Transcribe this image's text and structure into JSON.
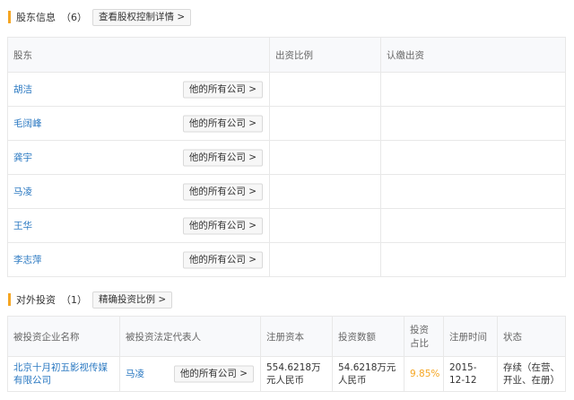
{
  "shareholders": {
    "title": "股东信息",
    "count": "（6）",
    "detail_button": "查看股权控制详情 >",
    "columns": [
      "股东",
      "出资比例",
      "认缴出资"
    ],
    "companies_button": "他的所有公司 >",
    "rows": [
      {
        "name": "胡洁",
        "ratio": "",
        "amount": ""
      },
      {
        "name": "毛阔峰",
        "ratio": "",
        "amount": ""
      },
      {
        "name": "龚宇",
        "ratio": "",
        "amount": ""
      },
      {
        "name": "马凌",
        "ratio": "",
        "amount": ""
      },
      {
        "name": "王华",
        "ratio": "",
        "amount": ""
      },
      {
        "name": "李志萍",
        "ratio": "",
        "amount": ""
      }
    ]
  },
  "investments": {
    "title": "对外投资",
    "count": "（1）",
    "ratio_button": "精确投资比例 >",
    "columns": [
      "被投资企业名称",
      "被投资法定代表人",
      "注册资本",
      "投资数额",
      "投资占比",
      "注册时间",
      "状态"
    ],
    "companies_button": "他的所有公司 >",
    "rows": [
      {
        "company": "北京十月初五影视传媒有限公司",
        "legal_rep": "马凌",
        "capital": "554.6218万元人民币",
        "amount": "54.6218万元人民币",
        "ratio": "9.85%",
        "date": "2015-12-12",
        "status": "存续（在营、开业、在册）"
      }
    ]
  },
  "colors": {
    "accent_bar": "#f5a623",
    "link": "#2b79c2",
    "ratio": "#f5a623"
  }
}
